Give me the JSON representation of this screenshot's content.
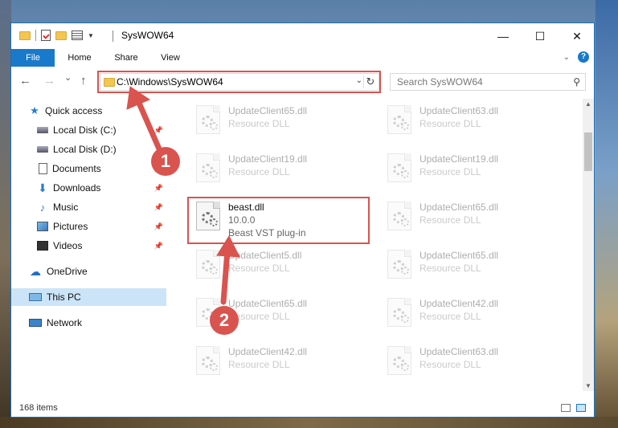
{
  "window": {
    "title": "SysWOW64",
    "controls": {
      "minimize": "—",
      "maximize": "☐",
      "close": "✕"
    }
  },
  "ribbon": {
    "tabs": [
      "File",
      "Home",
      "Share",
      "View"
    ],
    "help": "?"
  },
  "nav": {
    "back": "←",
    "forward": "→",
    "recent": "⌄",
    "up": "↑",
    "address": "C:\\Windows\\SysWOW64",
    "search_placeholder": "Search SysWOW64"
  },
  "sidebar": {
    "items": [
      {
        "label": "Quick access",
        "icon": "star-icon",
        "pinned": false
      },
      {
        "label": "Local Disk (C:)",
        "icon": "drive-icon",
        "pinned": true
      },
      {
        "label": "Local Disk (D:)",
        "icon": "drive-icon",
        "pinned": false
      },
      {
        "label": "Documents",
        "icon": "documents-icon",
        "pinned": true
      },
      {
        "label": "Downloads",
        "icon": "download-icon",
        "pinned": true
      },
      {
        "label": "Music",
        "icon": "music-icon",
        "pinned": true
      },
      {
        "label": "Pictures",
        "icon": "pictures-icon",
        "pinned": true
      },
      {
        "label": "Videos",
        "icon": "videos-icon",
        "pinned": true
      },
      {
        "label": "OneDrive",
        "icon": "cloud-icon",
        "pinned": false
      },
      {
        "label": "This PC",
        "icon": "computer-icon",
        "pinned": false,
        "selected": true
      },
      {
        "label": "Network",
        "icon": "network-icon",
        "pinned": false
      }
    ]
  },
  "files": {
    "left": [
      {
        "name": "UpdateClient65.dll",
        "type": "Resource DLL"
      },
      {
        "name": "UpdateClient19.dll",
        "type": "Resource DLL"
      },
      {
        "name": "beast.dll",
        "version": "10.0.0",
        "type": "Beast VST plug-in",
        "highlighted": true
      },
      {
        "name": "UpdateClient5.dll",
        "type": "Resource DLL"
      },
      {
        "name": "UpdateClient65.dll",
        "type": "Resource DLL"
      },
      {
        "name": "UpdateClient42.dll",
        "type": "Resource DLL"
      }
    ],
    "right": [
      {
        "name": "UpdateClient63.dll",
        "type": "Resource DLL"
      },
      {
        "name": "UpdateClient19.dll",
        "type": "Resource DLL"
      },
      {
        "name": "UpdateClient65.dll",
        "type": "Resource DLL"
      },
      {
        "name": "UpdateClient65.dll",
        "type": "Resource DLL"
      },
      {
        "name": "UpdateClient42.dll",
        "type": "Resource DLL"
      },
      {
        "name": "UpdateClient63.dll",
        "type": "Resource DLL"
      }
    ]
  },
  "status": {
    "item_count": "168 items"
  },
  "annotations": {
    "step1": "1",
    "step2": "2",
    "color": "#d9534f"
  }
}
